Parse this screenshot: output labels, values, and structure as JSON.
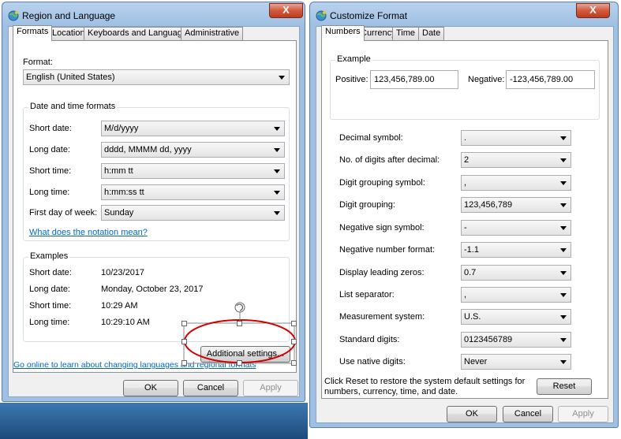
{
  "left_window": {
    "title": "Region and Language",
    "close_glyph": "X",
    "tabs": [
      "Formats",
      "Location",
      "Keyboards and Languages",
      "Administrative"
    ],
    "format_label": "Format:",
    "format_value": "English (United States)",
    "datetime_group_title": "Date and time formats",
    "datetime_rows": [
      {
        "label": "Short date:",
        "value": "M/d/yyyy"
      },
      {
        "label": "Long date:",
        "value": "dddd, MMMM dd, yyyy"
      },
      {
        "label": "Short time:",
        "value": "h:mm tt"
      },
      {
        "label": "Long time:",
        "value": "h:mm:ss tt"
      },
      {
        "label": "First day of week:",
        "value": "Sunday"
      }
    ],
    "notation_link": "What does the notation mean?",
    "examples_group_title": "Examples",
    "examples": [
      {
        "label": "Short date:",
        "value": "10/23/2017"
      },
      {
        "label": "Long date:",
        "value": "Monday, October 23, 2017"
      },
      {
        "label": "Short time:",
        "value": "10:29 AM"
      },
      {
        "label": "Long time:",
        "value": "10:29:10 AM"
      }
    ],
    "additional_settings": "Additional settings...",
    "online_link": "Go online to learn about changing languages and regional formats",
    "ok": "OK",
    "cancel": "Cancel",
    "apply": "Apply"
  },
  "right_window": {
    "title": "Customize Format",
    "close_glyph": "X",
    "tabs": [
      "Numbers",
      "Currency",
      "Time",
      "Date"
    ],
    "example_group_title": "Example",
    "positive_label": "Positive:",
    "positive_value": "123,456,789.00",
    "negative_label": "Negative:",
    "negative_value": "-123,456,789.00",
    "rows": [
      {
        "label": "Decimal symbol:",
        "value": "."
      },
      {
        "label": "No. of digits after decimal:",
        "value": "2"
      },
      {
        "label": "Digit grouping symbol:",
        "value": ","
      },
      {
        "label": "Digit grouping:",
        "value": "123,456,789"
      },
      {
        "label": "Negative sign symbol:",
        "value": "-"
      },
      {
        "label": "Negative number format:",
        "value": "-1.1"
      },
      {
        "label": "Display leading zeros:",
        "value": "0.7"
      },
      {
        "label": "List separator:",
        "value": ","
      },
      {
        "label": "Measurement system:",
        "value": "U.S."
      },
      {
        "label": "Standard digits:",
        "value": "0123456789"
      },
      {
        "label": "Use native digits:",
        "value": "Never"
      }
    ],
    "reset_text_line1": "Click Reset to restore the system default settings for",
    "reset_text_line2": "numbers, currency, time, and date.",
    "reset": "Reset",
    "ok": "OK",
    "cancel": "Cancel",
    "apply": "Apply"
  },
  "colors": {
    "annotation_red": "#d40000",
    "link_blue": "#0066cc"
  }
}
